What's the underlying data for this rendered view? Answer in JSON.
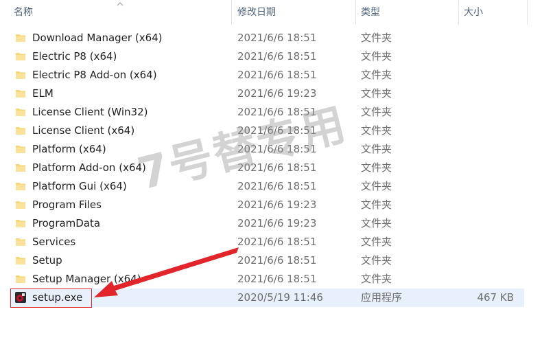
{
  "columns": {
    "name": "名称",
    "date": "修改日期",
    "type": "类型",
    "size": "大小"
  },
  "rows": [
    {
      "name": "Download Manager (x64)",
      "date": "2021/6/6 18:51",
      "type": "文件夹",
      "size": ""
    },
    {
      "name": "Electric P8 (x64)",
      "date": "2021/6/6 18:51",
      "type": "文件夹",
      "size": ""
    },
    {
      "name": "Electric P8 Add-on (x64)",
      "date": "2021/6/6 18:51",
      "type": "文件夹",
      "size": ""
    },
    {
      "name": "ELM",
      "date": "2021/6/6 19:23",
      "type": "文件夹",
      "size": ""
    },
    {
      "name": "License Client (Win32)",
      "date": "2021/6/6 18:51",
      "type": "文件夹",
      "size": ""
    },
    {
      "name": "License Client (x64)",
      "date": "2021/6/6 18:51",
      "type": "文件夹",
      "size": ""
    },
    {
      "name": "Platform (x64)",
      "date": "2021/6/6 18:51",
      "type": "文件夹",
      "size": ""
    },
    {
      "name": "Platform Add-on (x64)",
      "date": "2021/6/6 18:51",
      "type": "文件夹",
      "size": ""
    },
    {
      "name": "Platform Gui (x64)",
      "date": "2021/6/6 18:51",
      "type": "文件夹",
      "size": ""
    },
    {
      "name": "Program Files",
      "date": "2021/6/6 19:23",
      "type": "文件夹",
      "size": ""
    },
    {
      "name": "ProgramData",
      "date": "2021/6/6 19:23",
      "type": "文件夹",
      "size": ""
    },
    {
      "name": "Services",
      "date": "2021/6/6 18:51",
      "type": "文件夹",
      "size": ""
    },
    {
      "name": "Setup",
      "date": "2021/6/6 18:51",
      "type": "文件夹",
      "size": ""
    },
    {
      "name": "Setup Manager (x64)",
      "date": "2021/6/6 18:51",
      "type": "文件夹",
      "size": ""
    },
    {
      "name": "setup.exe",
      "date": "2020/5/19 11:46",
      "type": "应用程序",
      "size": "467 KB",
      "icon": "setup-exe-icon",
      "selected": true
    }
  ],
  "watermark": "7号替专用",
  "colors": {
    "folder": "#f8d775",
    "selection": "#e8f1fb",
    "annotation": "#e2242b"
  }
}
